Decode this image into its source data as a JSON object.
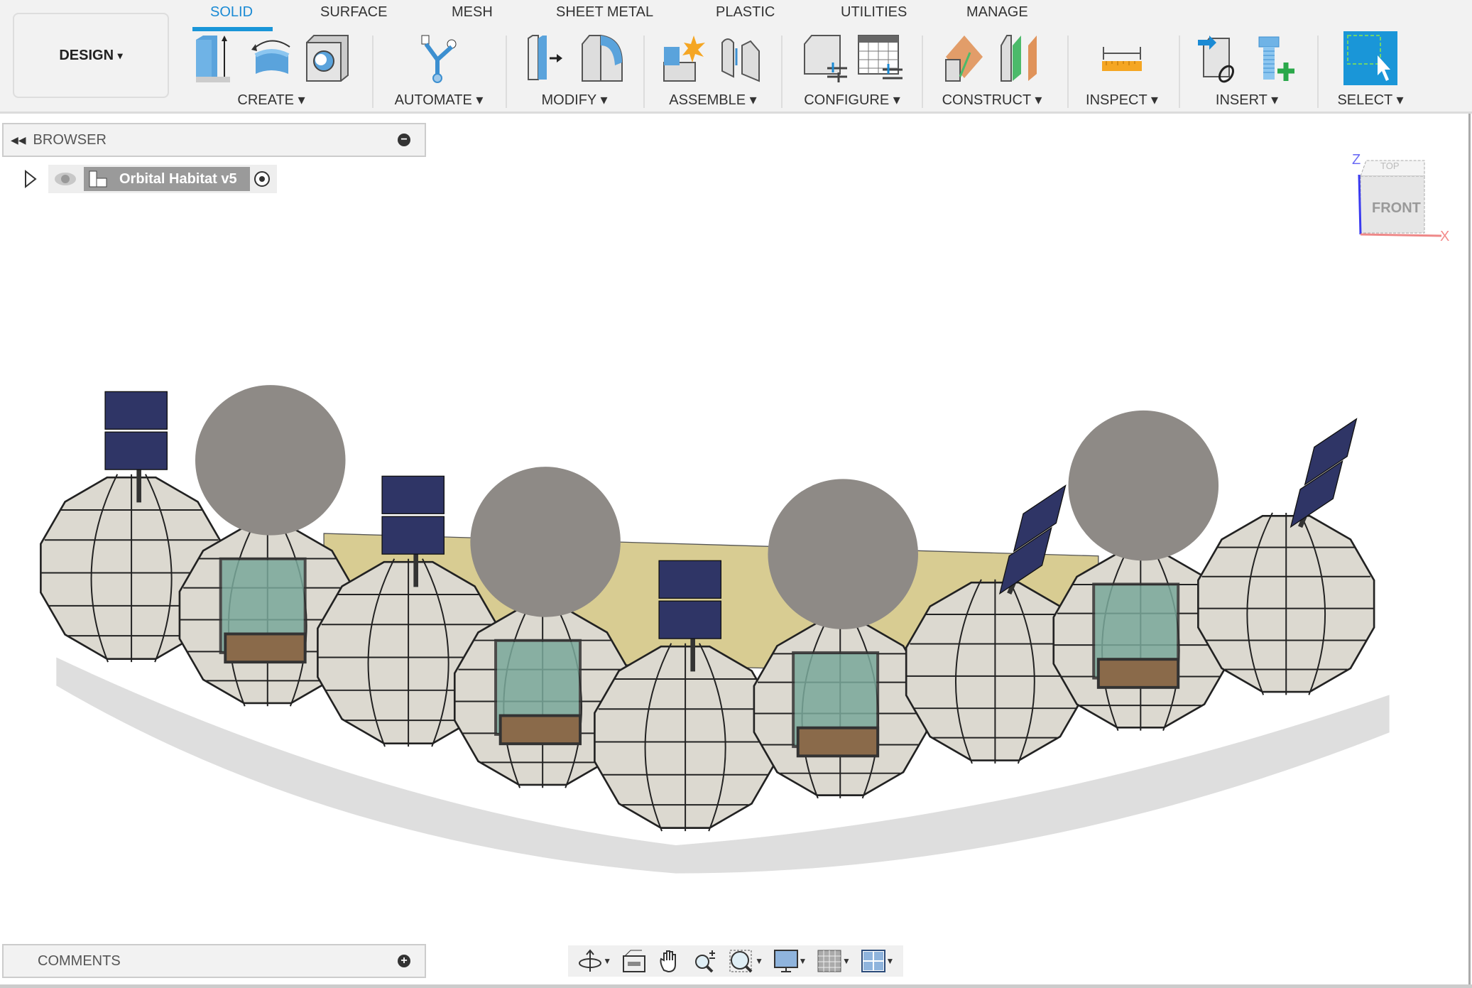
{
  "workspace_button": {
    "label": "DESIGN",
    "caret": "▾"
  },
  "tabs": [
    {
      "label": "SOLID",
      "active": true
    },
    {
      "label": "SURFACE"
    },
    {
      "label": "MESH"
    },
    {
      "label": "SHEET METAL"
    },
    {
      "label": "PLASTIC"
    },
    {
      "label": "UTILITIES"
    },
    {
      "label": "MANAGE"
    }
  ],
  "groups": [
    {
      "label": "CREATE ▾",
      "icons": [
        "extrude-icon",
        "revolve-icon",
        "hole-icon"
      ]
    },
    {
      "label": "AUTOMATE ▾",
      "icons": [
        "automate-icon"
      ]
    },
    {
      "label": "MODIFY ▾",
      "icons": [
        "press-pull-icon",
        "fillet-icon"
      ]
    },
    {
      "label": "ASSEMBLE ▾",
      "icons": [
        "new-component-icon",
        "joint-icon"
      ]
    },
    {
      "label": "CONFIGURE ▾",
      "icons": [
        "configure-icon",
        "configuration-table-icon"
      ]
    },
    {
      "label": "CONSTRUCT ▾",
      "icons": [
        "offset-plane-icon",
        "midplane-icon"
      ]
    },
    {
      "label": "INSPECT ▾",
      "icons": [
        "measure-icon"
      ]
    },
    {
      "label": "INSERT ▾",
      "icons": [
        "insert-derive-icon",
        "insert-mcmaster-icon"
      ]
    },
    {
      "label": "SELECT ▾",
      "icons": [
        "select-icon"
      ]
    }
  ],
  "browser": {
    "title": "BROWSER",
    "document": "Orbital Habitat v5"
  },
  "comments": {
    "title": "COMMENTS"
  },
  "viewcube": {
    "top": "TOP",
    "front": "FRONT",
    "axis_z": "Z",
    "axis_x": "X"
  },
  "nav_toolbar": [
    "orbit-icon",
    "look-at-icon",
    "pan-icon",
    "zoom-icon",
    "fit-icon",
    "display-settings-icon",
    "grid-icon",
    "viewports-icon"
  ],
  "colors": {
    "accent": "#1a96d8",
    "habitat": "#dcd9d0",
    "dome": "#8e8a86",
    "solar_panel": "#2f3566",
    "platform": "#d8cc92"
  }
}
